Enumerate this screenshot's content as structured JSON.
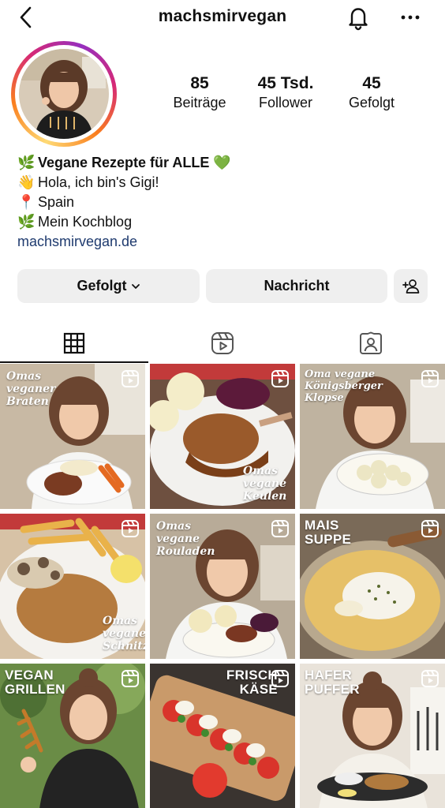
{
  "header": {
    "username": "machsmirvegan",
    "back_icon": "chevron-left-icon",
    "bell_icon": "bell-icon",
    "more_icon": "more-horizontal-icon"
  },
  "stats": [
    {
      "value": "85",
      "label": "Beiträge"
    },
    {
      "value": "45 Tsd.",
      "label": "Follower"
    },
    {
      "value": "45",
      "label": "Gefolgt"
    }
  ],
  "bio": {
    "lines": [
      {
        "emoji": "🌿",
        "text": "Vegane Rezepte für ALLE 💚",
        "bold": true
      },
      {
        "emoji": "👋",
        "text": "Hola, ich bin's Gigi!",
        "bold": false
      },
      {
        "emoji": "📍",
        "text": "Spain",
        "bold": false
      },
      {
        "emoji": "🌿",
        "text": "Mein Kochblog",
        "bold": false
      }
    ],
    "link": "machsmirvegan.de"
  },
  "actions": {
    "follow_label": "Gefolgt",
    "message_label": "Nachricht",
    "add_user_icon": "add-user-icon"
  },
  "tabs": [
    {
      "icon": "grid-icon",
      "active": true
    },
    {
      "icon": "reels-icon",
      "active": false
    },
    {
      "icon": "tagged-icon",
      "active": false
    }
  ],
  "posts": [
    {
      "caption": "Omas\nveganer\nBraten"
    },
    {
      "caption": "Omas\nvegane\nKeulen"
    },
    {
      "caption": "Oma vegane\nKönigsberger\nKlopse"
    },
    {
      "caption": "Omas\nvegane\nSchnitzel"
    },
    {
      "caption": "Omas\nvegane\nRouladen"
    },
    {
      "caption": "MAIS\nSUPPE"
    },
    {
      "caption": "VEGAN\nGRILLEN"
    },
    {
      "caption": "FRISCH\nKÄSE"
    },
    {
      "caption": "HAFER\nPUFFER"
    }
  ],
  "colors": {
    "link": "#1e3a6e",
    "button_bg": "#efefef",
    "story_ring": [
      "#feda75",
      "#fa7e1e",
      "#d62976",
      "#962fbf"
    ]
  }
}
